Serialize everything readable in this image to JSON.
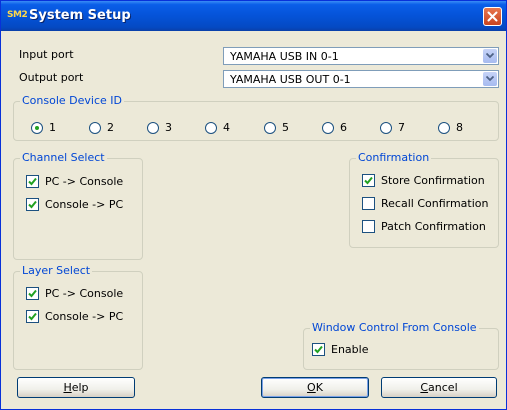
{
  "window": {
    "logo": "SM2",
    "title": "System Setup"
  },
  "ports": {
    "input_label": "Input port",
    "input_value": "YAMAHA USB IN 0-1",
    "output_label": "Output port",
    "output_value": "YAMAHA USB OUT 0-1"
  },
  "console_device_id": {
    "legend": "Console Device ID",
    "selected": "1",
    "options": [
      "1",
      "2",
      "3",
      "4",
      "5",
      "6",
      "7",
      "8"
    ]
  },
  "channel_select": {
    "legend": "Channel Select",
    "pc_to_console": "PC -> Console",
    "console_to_pc": "Console -> PC"
  },
  "confirmation": {
    "legend": "Confirmation",
    "store": "Store Confirmation",
    "recall": "Recall Confirmation",
    "patch": "Patch Confirmation"
  },
  "layer_select": {
    "legend": "Layer Select",
    "pc_to_console": "PC -> Console",
    "console_to_pc": "Console -> PC"
  },
  "window_control": {
    "legend": "Window Control From Console",
    "enable": "Enable"
  },
  "buttons": {
    "help_mn": "H",
    "help_rest": "elp",
    "ok_mn": "O",
    "ok_rest": "K",
    "cancel_mn": "C",
    "cancel_rest": "ancel"
  },
  "checks": {
    "channel_pc_to_console": true,
    "channel_console_to_pc": true,
    "store_confirmation": true,
    "recall_confirmation": false,
    "patch_confirmation": false,
    "layer_pc_to_console": true,
    "layer_console_to_pc": true,
    "enable": true
  },
  "colors": {
    "title_bar": "#0553d8",
    "legend_text": "#0046d5",
    "check_mark": "#21a121",
    "close_button": "#d8532f"
  }
}
